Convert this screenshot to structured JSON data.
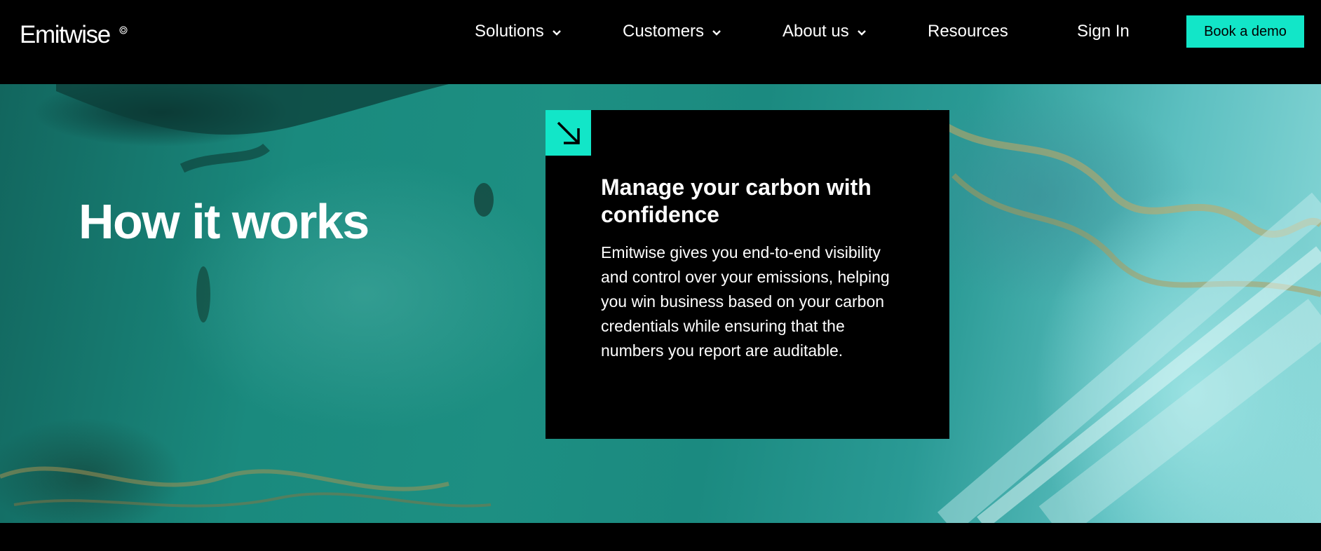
{
  "header": {
    "logo_text": "Emitwise",
    "nav": [
      {
        "label": "Solutions",
        "has_dropdown": true
      },
      {
        "label": "Customers",
        "has_dropdown": true
      },
      {
        "label": "About us",
        "has_dropdown": true
      },
      {
        "label": "Resources",
        "has_dropdown": false
      }
    ],
    "sign_in_label": "Sign In",
    "cta_label": "Book a demo"
  },
  "hero": {
    "title": "How it works",
    "card": {
      "icon": "arrow-down-right-icon",
      "heading": "Manage your carbon with confidence",
      "body": "Emitwise gives you end-to-end visibility and control over your emissions, helping you win business based on your carbon credentials while ensuring that the numbers you report are auditable."
    }
  },
  "colors": {
    "accent": "#12e6c8",
    "background": "#000000",
    "text": "#ffffff"
  }
}
